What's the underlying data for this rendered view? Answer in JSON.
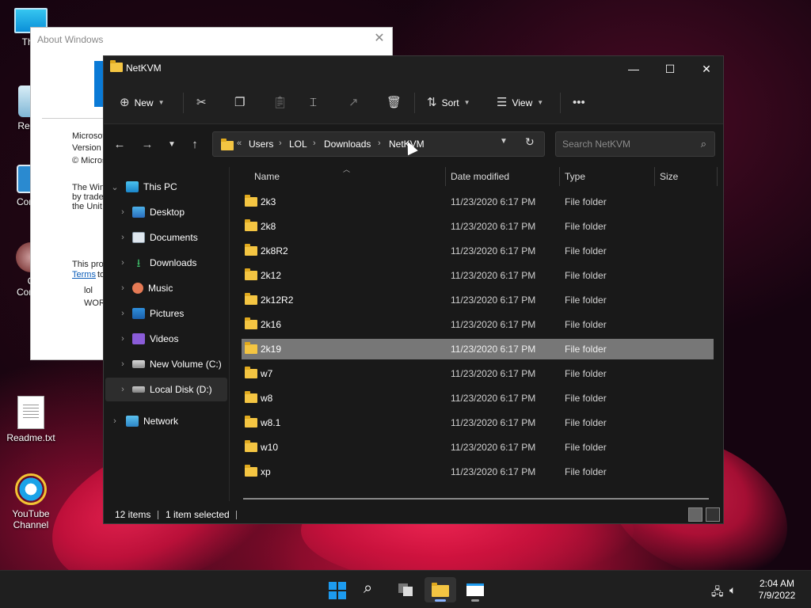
{
  "desktop": {
    "icons": [
      {
        "label": "This",
        "icon": "this-pc-icon"
      },
      {
        "label": "Recyc",
        "icon": "recycle-bin-icon"
      },
      {
        "label": "Contro",
        "icon": "control-panel-icon"
      },
      {
        "label": "C",
        "icon": "compression-icon"
      },
      {
        "label": "Compr",
        "icon": "compression-icon"
      },
      {
        "label": "Readme.txt",
        "icon": "text-file-icon"
      },
      {
        "label": "YouTube",
        "icon": "internet-explorer-icon"
      },
      {
        "label": "Channel",
        "icon": "internet-explorer-icon"
      }
    ]
  },
  "about_window": {
    "title": "About Windows",
    "close": "✕",
    "lines": [
      "Microsof",
      "Version",
      "© Micros",
      "The Win",
      "by trade",
      "the Unit",
      "This pro",
      "Terms",
      "to",
      "lol",
      "WOR"
    ]
  },
  "explorer": {
    "title": "NetKVM",
    "window_controls": {
      "minimize": "—",
      "maximize": "☐",
      "close": "✕"
    },
    "ribbon": {
      "new": "New",
      "sort": "Sort",
      "view": "View",
      "more": "•••",
      "icons": [
        "cut-icon",
        "copy-icon",
        "paste-icon",
        "rename-icon",
        "share-icon",
        "delete-icon"
      ]
    },
    "address": {
      "overflow": "«",
      "crumbs": [
        "Users",
        "LOL",
        "Downloads",
        "NetKVM"
      ],
      "separator": "›"
    },
    "search": {
      "placeholder": "Search NetKVM"
    },
    "nav": {
      "this_pc": "This PC",
      "items": [
        "Desktop",
        "Documents",
        "Downloads",
        "Music",
        "Pictures",
        "Videos",
        "New Volume (C:)",
        "Local Disk (D:)"
      ],
      "network": "Network"
    },
    "columns": {
      "name": "Name",
      "date": "Date modified",
      "type": "Type",
      "size": "Size"
    },
    "rows": [
      {
        "name": "2k3",
        "date": "11/23/2020 6:17 PM",
        "type": "File folder"
      },
      {
        "name": "2k8",
        "date": "11/23/2020 6:17 PM",
        "type": "File folder"
      },
      {
        "name": "2k8R2",
        "date": "11/23/2020 6:17 PM",
        "type": "File folder"
      },
      {
        "name": "2k12",
        "date": "11/23/2020 6:17 PM",
        "type": "File folder"
      },
      {
        "name": "2k12R2",
        "date": "11/23/2020 6:17 PM",
        "type": "File folder"
      },
      {
        "name": "2k16",
        "date": "11/23/2020 6:17 PM",
        "type": "File folder"
      },
      {
        "name": "2k19",
        "date": "11/23/2020 6:17 PM",
        "type": "File folder",
        "selected": true
      },
      {
        "name": "w7",
        "date": "11/23/2020 6:17 PM",
        "type": "File folder"
      },
      {
        "name": "w8",
        "date": "11/23/2020 6:17 PM",
        "type": "File folder"
      },
      {
        "name": "w8.1",
        "date": "11/23/2020 6:17 PM",
        "type": "File folder"
      },
      {
        "name": "w10",
        "date": "11/23/2020 6:17 PM",
        "type": "File folder"
      },
      {
        "name": "xp",
        "date": "11/23/2020 6:17 PM",
        "type": "File folder"
      }
    ],
    "status": {
      "count": "12 items",
      "selected": "1 item selected"
    }
  },
  "taskbar": {
    "clock_time": "2:04 AM",
    "clock_date": "7/9/2022"
  }
}
